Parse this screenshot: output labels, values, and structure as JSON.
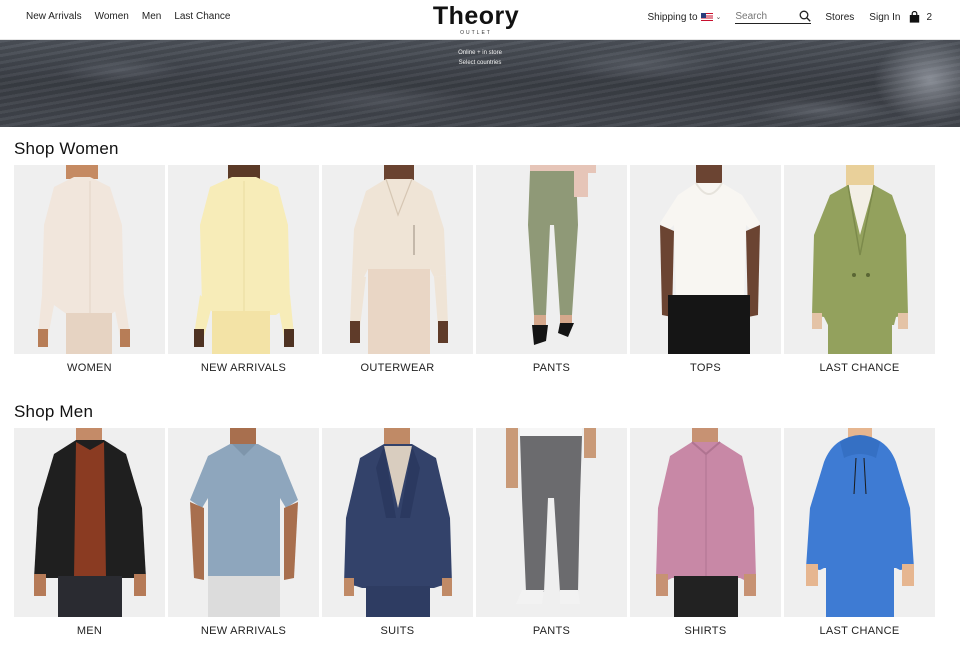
{
  "header": {
    "nav_left": [
      "New Arrivals",
      "Women",
      "Men",
      "Last Chance"
    ],
    "logo_main": "Theory",
    "logo_sub": "OUTLET",
    "shipping_label": "Shipping to",
    "search_placeholder": "Search",
    "stores_label": "Stores",
    "signin_label": "Sign In",
    "bag_count": "2"
  },
  "banner": {
    "line1": "Online + in store",
    "line2": "Select countries"
  },
  "women": {
    "title": "Shop Women",
    "items": [
      "WOMEN",
      "NEW ARRIVALS",
      "OUTERWEAR",
      "PANTS",
      "TOPS",
      "LAST CHANCE"
    ]
  },
  "men": {
    "title": "Shop Men",
    "items": [
      "MEN",
      "NEW ARRIVALS",
      "SUITS",
      "PANTS",
      "SHIRTS",
      "LAST CHANCE"
    ]
  },
  "colors": {
    "tile_bg": "#efefef",
    "text": "#111111"
  }
}
